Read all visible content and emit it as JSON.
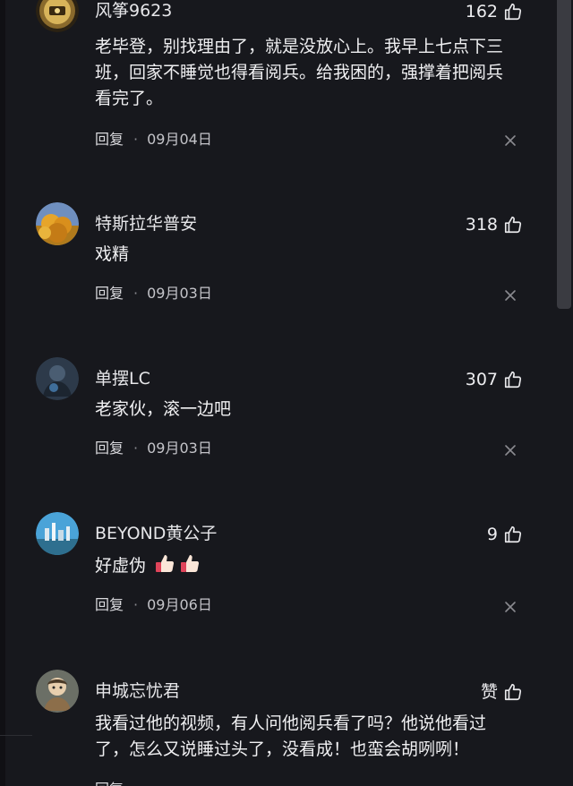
{
  "comments": [
    {
      "username": "风筝9623",
      "likes": "162",
      "content": "老毕登，别找理由了，就是没放心上。我早上七点下三班，回家不睡觉也得看阅兵。给我困的，强撑着把阅兵看完了。",
      "reply_label": "回复",
      "separator": "·",
      "date": "09月04日",
      "avatar_icon": "gold-badge-avatar"
    },
    {
      "username": "特斯拉华普安",
      "likes": "318",
      "content": "戏精",
      "reply_label": "回复",
      "separator": "·",
      "date": "09月03日",
      "avatar_icon": "autumn-tree-avatar"
    },
    {
      "username": "单摆LC",
      "likes": "307",
      "content": "老家伙，滚一边吧",
      "reply_label": "回复",
      "separator": "·",
      "date": "09月03日",
      "avatar_icon": "dark-figure-avatar"
    },
    {
      "username": "BEYOND黄公子",
      "likes": "9",
      "content": "好虚伪",
      "content_emoji": "thumbs-up-emoji",
      "reply_label": "回复",
      "separator": "·",
      "date": "09月06日",
      "avatar_icon": "city-skyline-avatar"
    },
    {
      "username": "申城忘忧君",
      "likes": "赞",
      "content": "我看过他的视频，有人问他阅兵看了吗？他说他看过了，怎么又说睡过头了，没看成！也蛮会胡咧咧！",
      "reply_label": "回复",
      "avatar_icon": "cartoon-person-avatar"
    }
  ],
  "colors": {
    "background": "#17181d",
    "text": "#f0f0f2",
    "meta": "#c4c4c9",
    "scrollbar": "#3a3b41"
  }
}
